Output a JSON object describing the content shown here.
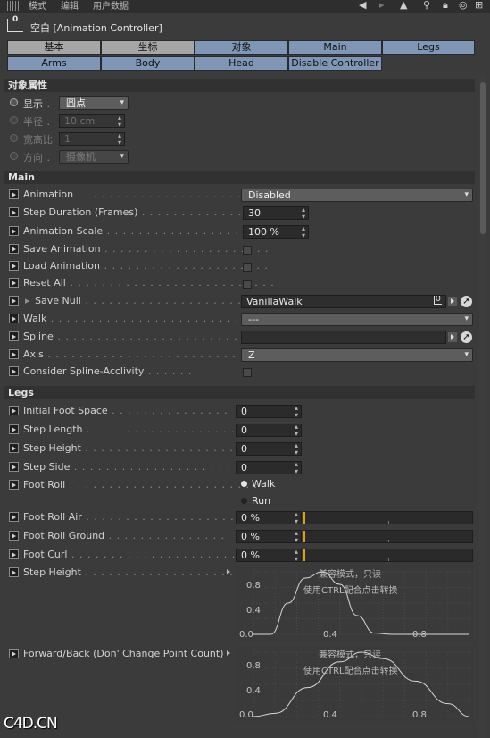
{
  "menubar": {
    "items": [
      "模式",
      "编辑",
      "用户数据"
    ]
  },
  "header": {
    "object_icon_label": "0",
    "title": "空白 [Animation Controller]"
  },
  "tabs_row1": [
    {
      "label": "基本",
      "active": false
    },
    {
      "label": "坐标",
      "active": false
    },
    {
      "label": "对象",
      "active": true
    },
    {
      "label": "Main",
      "active": true
    },
    {
      "label": "Legs",
      "active": true
    }
  ],
  "tabs_row2": [
    {
      "label": "Arms",
      "active": true
    },
    {
      "label": "Body",
      "active": true
    },
    {
      "label": "Head",
      "active": true
    },
    {
      "label": "Disable Controller",
      "active": true
    }
  ],
  "object_props": {
    "section_title": "对象属性",
    "display": {
      "label": "显示",
      "value": "圆点"
    },
    "radius": {
      "label": "半径",
      "value": "10 cm"
    },
    "aspect": {
      "label": "宽高比",
      "value": "1"
    },
    "orientation": {
      "label": "方向",
      "value": "摄像机"
    }
  },
  "main": {
    "section_title": "Main",
    "animation": {
      "label": "Animation",
      "value": "Disabled"
    },
    "step_duration": {
      "label": "Step Duration (Frames)",
      "value": "30"
    },
    "animation_scale": {
      "label": "Animation Scale",
      "value": "100 %"
    },
    "save_animation": {
      "label": "Save Animation"
    },
    "load_animation": {
      "label": "Load Animation"
    },
    "reset_all": {
      "label": "Reset All"
    },
    "save_null": {
      "label": "Save Null",
      "value": "VanillaWalk",
      "icon_label": "0"
    },
    "walk": {
      "label": "Walk",
      "value": "---"
    },
    "spline": {
      "label": "Spline",
      "value": ""
    },
    "axis": {
      "label": "Axis",
      "value": "Z"
    },
    "consider_spline": {
      "label": "Consider Spline-Acclivity"
    }
  },
  "legs": {
    "section_title": "Legs",
    "initial_foot_space": {
      "label": "Initial Foot Space",
      "value": "0"
    },
    "step_length": {
      "label": "Step Length",
      "value": "0"
    },
    "step_height": {
      "label": "Step Height",
      "value": "0"
    },
    "step_side": {
      "label": "Step Side",
      "value": "0"
    },
    "foot_roll": {
      "label": "Foot Roll",
      "options": [
        "Walk",
        "Run"
      ],
      "selected": "Walk"
    },
    "foot_roll_air": {
      "label": "Foot Roll Air",
      "value": "0 %",
      "fraction": 0.0
    },
    "foot_roll_ground": {
      "label": "Foot Roll Ground",
      "value": "0 %",
      "fraction": 0.0
    },
    "foot_curl": {
      "label": "Foot Curl",
      "value": "0 %",
      "fraction": 0.0
    },
    "step_height_curve": {
      "label": "Step Height",
      "warning_1": "兼容模式，只读",
      "warning_2": "使用CTRL配合点击转换",
      "y_ticks": [
        "0.8",
        "0.4",
        "0.0"
      ],
      "x_ticks": [
        "0.4",
        "0.8"
      ],
      "curve_points": [
        [
          0.0,
          0.0
        ],
        [
          0.08,
          0.0
        ],
        [
          0.16,
          0.5
        ],
        [
          0.24,
          0.9
        ],
        [
          0.32,
          1.0
        ],
        [
          0.4,
          0.8
        ],
        [
          0.48,
          0.3
        ],
        [
          0.56,
          0.02
        ],
        [
          0.64,
          0.0
        ],
        [
          1.0,
          0.0
        ]
      ]
    },
    "forward_back_curve": {
      "label": "Forward/Back (Don' Change Point Count)",
      "warning_1": "兼容模式，只读",
      "warning_2": "使用CTRL配合点击转换",
      "y_ticks": [
        "0.8",
        "0.4",
        "0.0"
      ],
      "x_ticks": [
        "0.4",
        "0.8"
      ],
      "curve_points": [
        [
          0.0,
          0.0
        ],
        [
          0.1,
          0.05
        ],
        [
          0.25,
          0.45
        ],
        [
          0.4,
          0.85
        ],
        [
          0.5,
          1.0
        ],
        [
          0.6,
          0.9
        ],
        [
          0.75,
          0.55
        ],
        [
          0.9,
          0.2
        ],
        [
          1.0,
          0.0
        ]
      ]
    }
  },
  "watermark": "C4D.CN"
}
